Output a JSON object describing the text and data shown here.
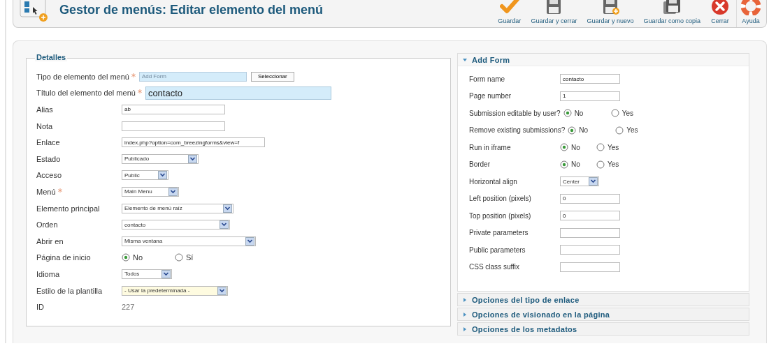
{
  "header": {
    "title": "Gestor de menús: Editar elemento del menú",
    "toolbar": [
      {
        "label": "Guardar"
      },
      {
        "label": "Guardar y cerrar"
      },
      {
        "label": "Guardar y nuevo"
      },
      {
        "label": "Guardar como copia"
      },
      {
        "label": "Cerrar"
      },
      {
        "label": "Ayuda"
      }
    ]
  },
  "details": {
    "legend": "Detalles",
    "fields": [
      {
        "kind": "picker",
        "label": "Tipo de elemento del menú",
        "required": true,
        "placeholder": "Add Form",
        "button": "Seleccionar"
      },
      {
        "kind": "big",
        "label": "Título del elemento del menú",
        "required": true,
        "value": "contacto"
      },
      {
        "kind": "text",
        "label": "Alias",
        "required": false,
        "value": "ab"
      },
      {
        "kind": "text",
        "label": "Nota",
        "required": false
      },
      {
        "kind": "text",
        "label": "Enlace",
        "required": false,
        "value": "index.php?option=com_breezingforms&view=f"
      },
      {
        "kind": "select",
        "label": "Estado",
        "required": false,
        "value": "Publicado"
      },
      {
        "kind": "select",
        "label": "Acceso",
        "required": false,
        "value": "Public"
      },
      {
        "kind": "select",
        "label": "Menú",
        "required": true,
        "value": "Main Menu"
      },
      {
        "kind": "select",
        "label": "Elemento principal",
        "required": false,
        "value": "Elemento de menú raíz"
      },
      {
        "kind": "select",
        "label": "Orden",
        "required": false,
        "value": "contacto"
      },
      {
        "kind": "select",
        "label": "Abrir en",
        "required": false,
        "value": "Misma ventana"
      },
      {
        "kind": "radio",
        "label": "Página de inicio",
        "required": false,
        "options": [
          {
            "label": "No",
            "selected": true
          },
          {
            "label": "Sí",
            "selected": false
          }
        ]
      },
      {
        "kind": "select",
        "label": "Idioma",
        "required": false,
        "value": "Todos"
      },
      {
        "kind": "select",
        "label": "Estilo de la plantilla",
        "required": false,
        "value": "- Usar la predeterminada -",
        "highlighted": true
      },
      {
        "kind": "readonly",
        "label": "ID",
        "required": false,
        "value": "227"
      }
    ]
  },
  "panels": [
    {
      "title": "Add Form",
      "expanded": true,
      "fields": [
        {
          "kind": "text",
          "label": "Form name",
          "value": "contacto"
        },
        {
          "kind": "text",
          "label": "Page number",
          "value": "1"
        },
        {
          "kind": "radio-inline",
          "label": "Submission editable by user?",
          "options": [
            {
              "label": "No",
              "selected": true
            },
            {
              "label": "Yes",
              "selected": false
            }
          ]
        },
        {
          "kind": "radio-inline",
          "label": "Remove existing submissions?",
          "options": [
            {
              "label": "No",
              "selected": true
            },
            {
              "label": "Yes",
              "selected": false
            }
          ]
        },
        {
          "kind": "radio",
          "label": "Run in iframe",
          "options": [
            {
              "label": "No",
              "selected": true
            },
            {
              "label": "Yes",
              "selected": false
            }
          ]
        },
        {
          "kind": "radio",
          "label": "Border",
          "options": [
            {
              "label": "No",
              "selected": true
            },
            {
              "label": "Yes",
              "selected": false
            }
          ]
        },
        {
          "kind": "select",
          "label": "Horizontal align",
          "value": "Center"
        },
        {
          "kind": "text",
          "label": "Left position (pixels)",
          "value": "0"
        },
        {
          "kind": "text",
          "label": "Top position (pixels)",
          "value": "0"
        },
        {
          "kind": "text",
          "label": "Private parameters"
        },
        {
          "kind": "text",
          "label": "Public parameters"
        },
        {
          "kind": "text",
          "label": "CSS class suffix"
        }
      ]
    },
    {
      "title": "Opciones del tipo de enlace",
      "expanded": false
    },
    {
      "title": "Opciones de visionado en la página",
      "expanded": false
    },
    {
      "title": "Opciones de los metadatos",
      "expanded": false
    }
  ]
}
